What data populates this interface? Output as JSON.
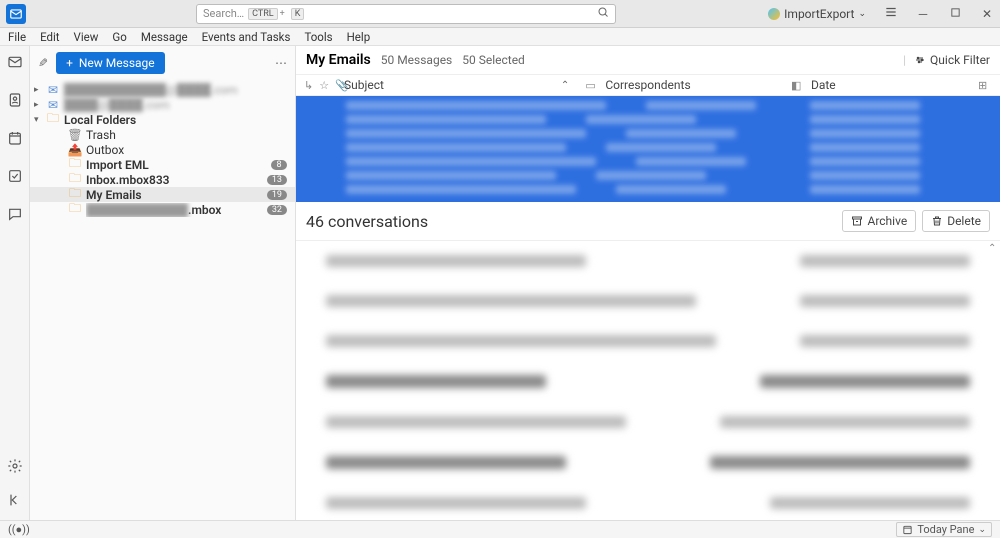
{
  "titlebar": {
    "search_placeholder": "Search…",
    "kbd1": "CTRL",
    "kbd_plus": "+",
    "kbd2": "K",
    "import_export": "ImportExport"
  },
  "menu": {
    "file": "File",
    "edit": "Edit",
    "view": "View",
    "go": "Go",
    "message": "Message",
    "events": "Events and Tasks",
    "tools": "Tools",
    "help": "Help"
  },
  "sidebar": {
    "new_message": "New Message",
    "local_folders": "Local Folders",
    "trash": "Trash",
    "outbox": "Outbox",
    "import_eml": "Import EML",
    "import_eml_count": "8",
    "inbox_mbox": "Inbox.mbox833",
    "inbox_mbox_count": "13",
    "my_emails": "My Emails",
    "my_emails_count": "19",
    "mbox_suffix": ".mbox",
    "mbox_count": "32"
  },
  "header": {
    "title": "My Emails",
    "messages": "50 Messages",
    "selected": "50 Selected",
    "quick_filter": "Quick Filter"
  },
  "cols": {
    "subject": "Subject",
    "correspondents": "Correspondents",
    "date": "Date"
  },
  "conv": {
    "title": "46 conversations",
    "archive": "Archive",
    "delete": "Delete"
  },
  "status": {
    "today_pane": "Today Pane"
  }
}
